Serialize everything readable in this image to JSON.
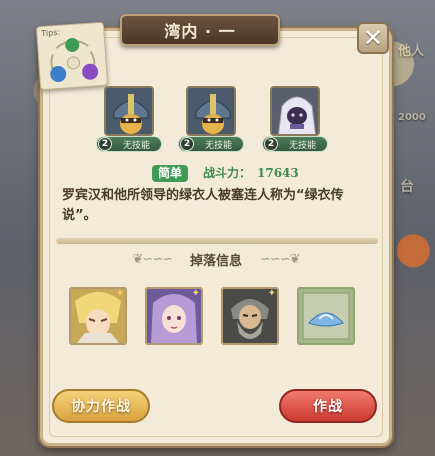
{
  "dialog": {
    "title": "湾内 · 一",
    "close_icon": "close-icon"
  },
  "tips": {
    "label": "Tips:",
    "diagram_icon": "element-cycle-icon"
  },
  "enemies": [
    {
      "level": "2",
      "skill": "无技能",
      "icon": "helmeted-soldier-portrait"
    },
    {
      "level": "2",
      "skill": "无技能",
      "icon": "helmeted-soldier-portrait"
    },
    {
      "level": "2",
      "skill": "无技能",
      "icon": "hooded-figure-portrait"
    }
  ],
  "stage": {
    "difficulty": "简单",
    "power_label": "战斗力：",
    "power_value": "17643",
    "description": "罗宾汉和他所领导的绿衣人被塞连人称为“绿衣传说”。"
  },
  "drops": {
    "header": "掉落信息",
    "items": [
      {
        "icon": "blonde-hero-portrait"
      },
      {
        "icon": "purple-haired-hero-portrait"
      },
      {
        "icon": "bearded-warrior-portrait"
      },
      {
        "icon": "blue-crystal-item"
      }
    ]
  },
  "buttons": {
    "coop": "协力作战",
    "fight": "作战"
  },
  "background": {
    "right_labels": [
      "他人",
      "台"
    ],
    "left_label": "2000"
  },
  "colors": {
    "panel": "#f3ebd8",
    "title_banner": "#5a4333",
    "difficulty_badge": "#3f9a55",
    "power_text": "#3f8a4f",
    "coop_button": "#e2b457",
    "fight_button": "#dc4c42"
  }
}
